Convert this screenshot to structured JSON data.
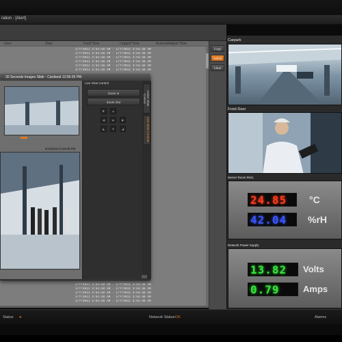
{
  "titlebar": {
    "text": "ration - [Alert]"
  },
  "log": {
    "columns": [
      "User",
      "Start",
      "Fault Time",
      "Logged Time",
      "Acknowledged Time"
    ],
    "rows": [
      "1/7/2011 3:54:48 AM  ·  1/7/2011 3:54:48 AM",
      "1/7/2011 3:54:48 AM  ·  1/7/2011 3:54:48 AM",
      "1/7/2011 3:54:48 AM  ·  1/7/2011 3:54:48 AM",
      "1/7/2011 3:54:48 AM  ·  1/7/2011 3:54:48 AM",
      "1/7/2011 3:54:48 AM  ·  1/7/2011 3:54:48 AM",
      "1/7/2011 3:54:48 AM  ·  1/7/2011 3:54:48 AM"
    ],
    "bottom_rows": [
      "1/7/2011 3:54:48 AM  ·  1/7/2011 3:54:48 AM",
      "1/7/2011 3:54:48 AM  ·  1/7/2011 3:54:48 AM",
      "1/7/2011 3:54:48 AM  ·  1/7/2011 3:54:48 AM",
      "1/7/2011 3:54:48 AM  ·  1/7/2011 3:54:48 AM",
      "1/7/2011 3:54:48 AM  ·  1/7/2011 3:54:48 AM"
    ]
  },
  "actions": {
    "copy": "Copy",
    "action": "Action",
    "clear": "Clear"
  },
  "floating_window": {
    "title": "30 Seconds Images Slide - Cardiand 12:56:26 PM",
    "image_timestamp": "5/16/2012 6:45:09 PM",
    "live_view_title": "Live View Control",
    "zoom_in": "Zoom In",
    "zoom_out": "Zoom Out",
    "tab_active_alarm": "Active View Control",
    "tab_live_view": "Live View Controls"
  },
  "cameras": {
    "carpark": "Carpark",
    "front_door": "Front Door",
    "server_room": "Server Room RH/L",
    "network_power": "Network Power Supply"
  },
  "sensors": {
    "temperature": {
      "value": "24.85",
      "unit": "°C",
      "color": "#ff3b1f"
    },
    "humidity": {
      "value": "42.04",
      "unit": "%rH",
      "color": "#3a56ff"
    },
    "volts": {
      "value": "13.82",
      "unit": "Volts",
      "color": "#35e33a"
    },
    "amps": {
      "value": "0.79",
      "unit": "Amps",
      "color": "#35e33a"
    }
  },
  "statusbar": {
    "status_label": "Status",
    "network_status_label": "Network Status:",
    "network_status_value": "OK",
    "alarms_label": "Alarms"
  },
  "colors": {
    "accent": "#e07a22",
    "ok": "#e07a22"
  }
}
